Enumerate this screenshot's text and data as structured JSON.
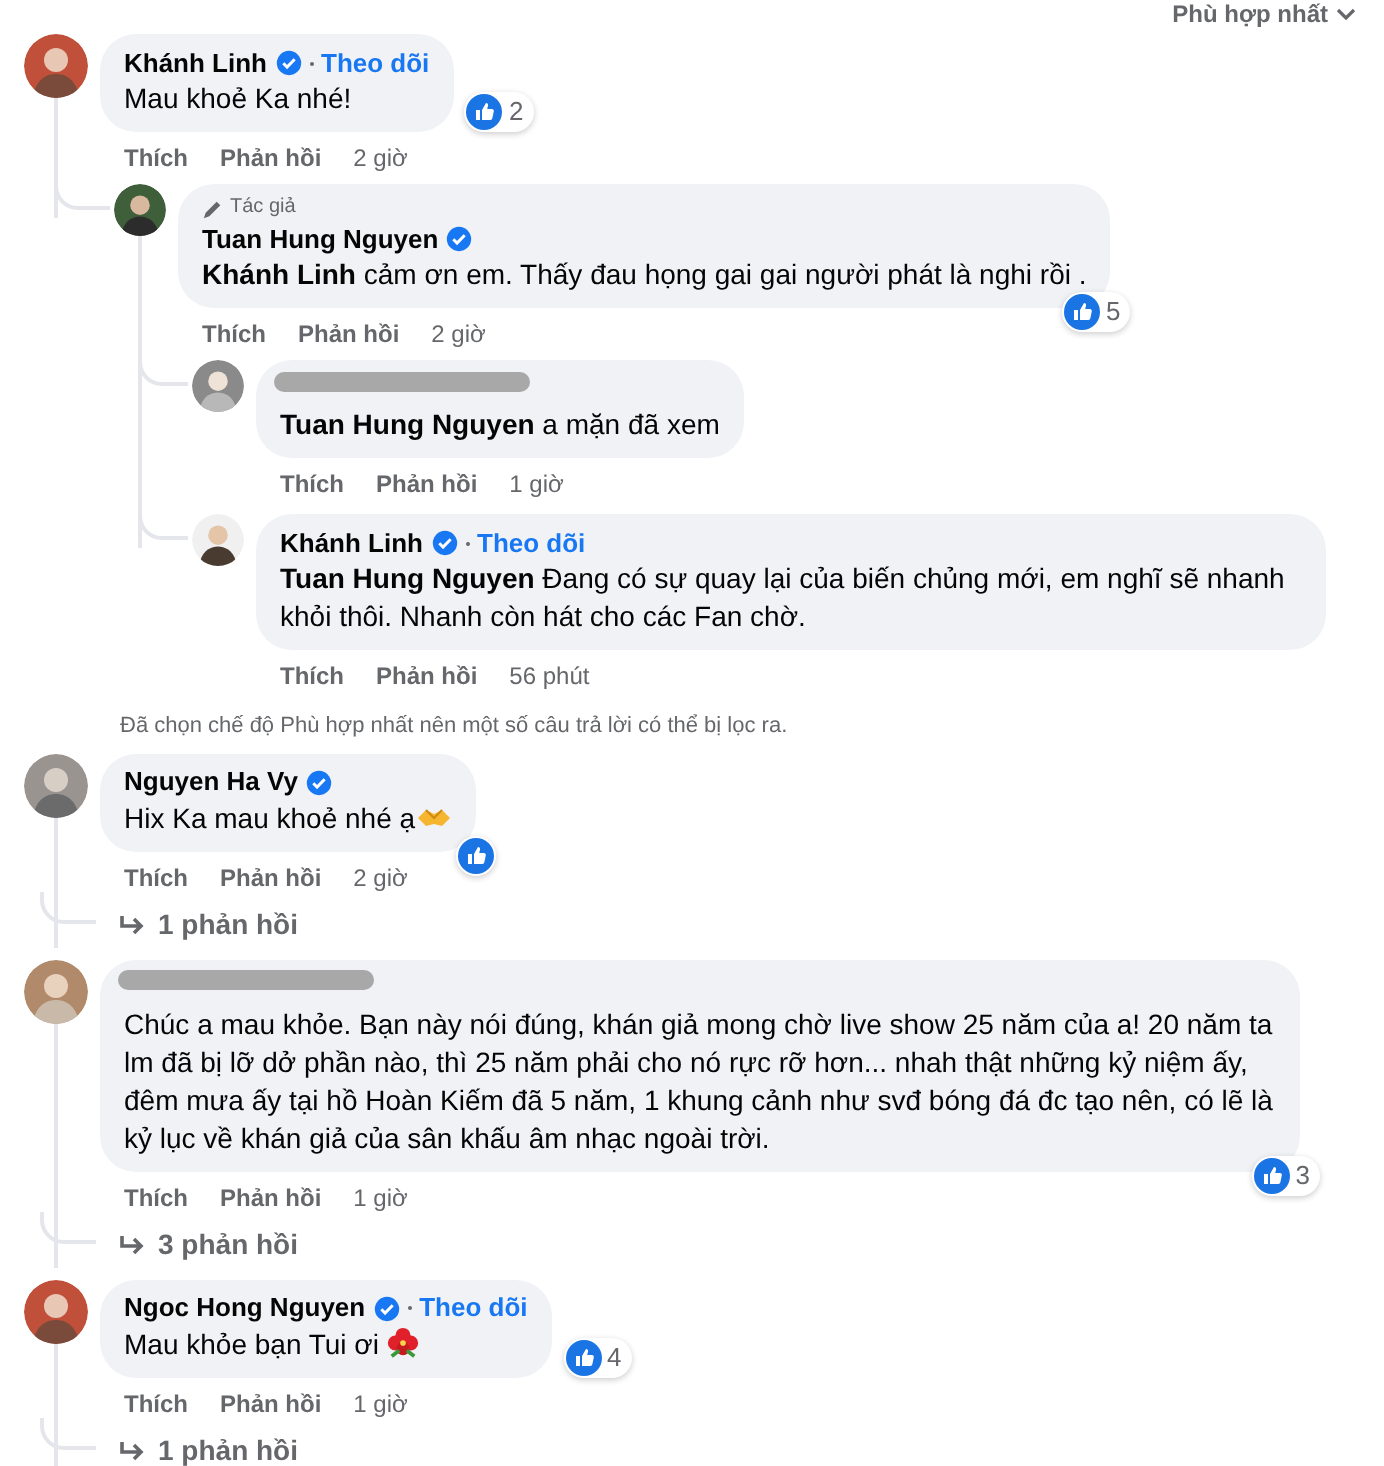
{
  "sort": {
    "label": "Phù hợp nhất"
  },
  "comments": [
    {
      "name": "Khánh Linh",
      "verified": true,
      "follow": "Theo dõi",
      "text": "Mau khoẻ Ka nhé!",
      "reacted": true,
      "reaction_count": "2",
      "like": "Thích",
      "reply": "Phản hồi",
      "time": "2 giờ",
      "children": [
        {
          "name": "Tuan Hung Nguyen",
          "verified": true,
          "author_badge": "Tác giả",
          "text": "**Khánh Linh** cảm ơn em. Thấy đau họng gai gai người phát là nghi rồi .",
          "reacted": true,
          "reaction_count": "5",
          "like": "Thích",
          "reply": "Phản hồi",
          "time": "2 giờ",
          "children": [
            {
              "redacted": true,
              "text": "**Tuan Hung Nguyen** a mặn đã xem",
              "like": "Thích",
              "reply": "Phản hồi",
              "time": "1 giờ"
            },
            {
              "name": "Khánh Linh",
              "verified": true,
              "follow": "Theo dõi",
              "text": "**Tuan Hung Nguyen** Đang có sự quay lại của biến chủng mới, em nghĩ sẽ nhanh khỏi thôi. Nhanh còn hát cho các Fan chờ.",
              "like": "Thích",
              "reply": "Phản hồi",
              "time": "56 phút"
            }
          ]
        }
      ]
    },
    {
      "kind": "note",
      "text": "Đã chọn chế độ Phù hợp nhất nên một số câu trả lời có thể bị lọc ra."
    },
    {
      "name": "Nguyen Ha Vy",
      "verified": true,
      "text": "Hix Ka mau khoẻ nhé ạ",
      "emoji": {
        "kind": "hands"
      },
      "reacted": true,
      "like": "Thích",
      "reply": "Phản hồi",
      "time": "2 giờ",
      "replies_link": "1 phản hồi"
    },
    {
      "redacted": true,
      "text": "Chúc a mau khỏe. Bạn này nói đúng, khán giả mong chờ live show 25 năm của a! 20 năm ta lm đã bị lỡ dở phần nào, thì 25 năm phải cho nó rực rỡ hơn... nhah thật những kỷ niệm ấy, đêm mưa ấy tại hồ Hoàn Kiếm đã 5 năm, 1 khung cảnh như svđ bóng đá đc tạo nên, có lẽ là kỷ lục về khán giả của sân khấu âm nhạc ngoài trời.",
      "reacted": true,
      "reaction_count": "3",
      "like": "Thích",
      "reply": "Phản hồi",
      "time": "1 giờ",
      "replies_link": "3 phản hồi"
    },
    {
      "name": "Ngoc Hong Nguyen",
      "verified": true,
      "follow": "Theo dõi",
      "text": "Mau khỏe bạn Tui ơi",
      "emoji": {
        "kind": "flower"
      },
      "reacted": true,
      "reaction_count": "4",
      "like": "Thích",
      "reply": "Phản hồi",
      "time": "1 giờ",
      "replies_link": "1 phản hồi"
    }
  ]
}
